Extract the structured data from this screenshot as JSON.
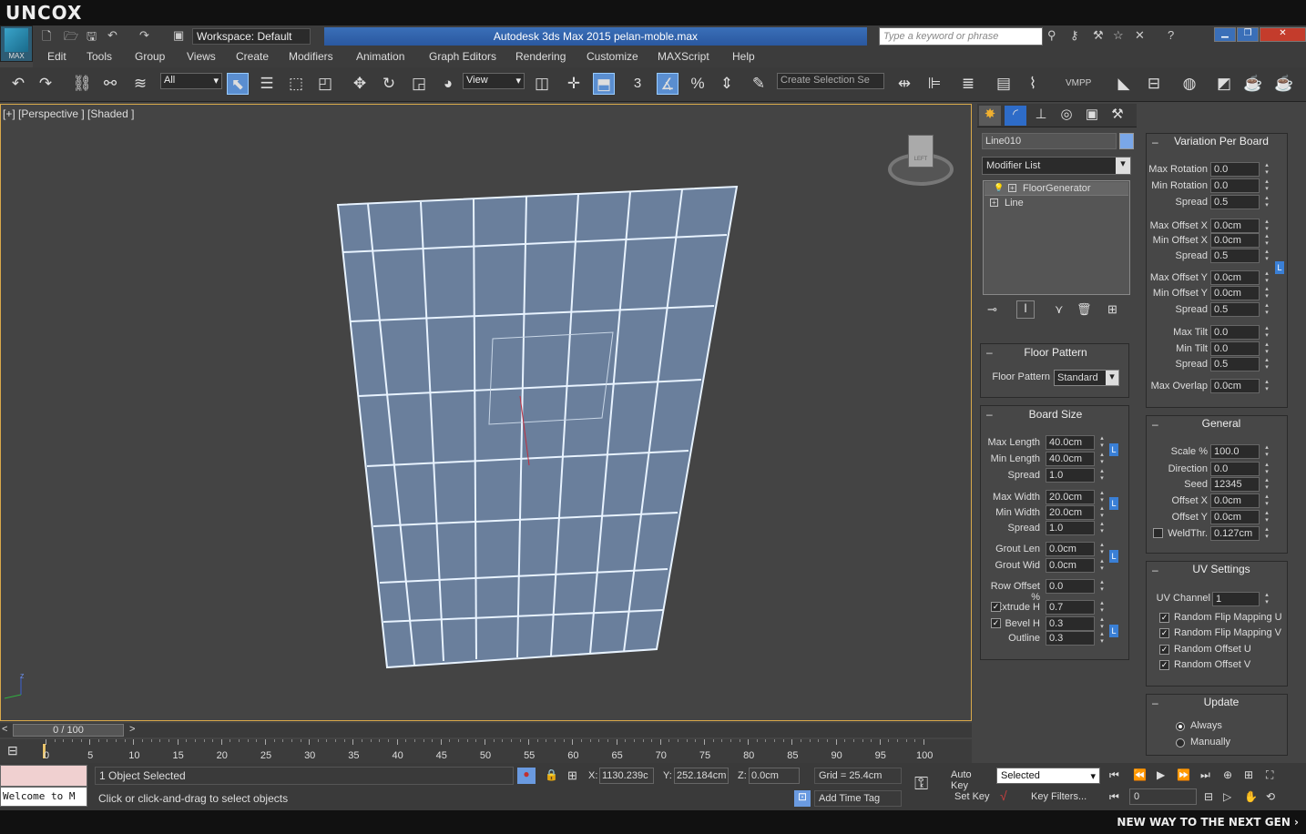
{
  "brand": {
    "logo": "UNCOX",
    "tagline": "NEW WAY TO THE NEXT GEN ›"
  },
  "app": {
    "max_button": "MAX",
    "title": "Autodesk 3ds Max  2015     pelan-moble.max",
    "workspace": "Workspace: Default",
    "search_placeholder": "Type a keyword or phrase"
  },
  "menu": [
    "Edit",
    "Tools",
    "Group",
    "Views",
    "Create",
    "Modifiers",
    "Animation",
    "Graph Editors",
    "Rendering",
    "Customize",
    "MAXScript",
    "Help"
  ],
  "toolbar": {
    "selection_filter": "All",
    "ref_coord": "View",
    "named_selection": "Create Selection Se",
    "snap_3": "3",
    "vmpp": "VMPP"
  },
  "viewport": {
    "label": "[+] [Perspective ] [Shaded ]",
    "viewcube": "LEFT"
  },
  "command_panel": {
    "object_name": "Line010",
    "modifier_list": "Modifier List",
    "stack": [
      "FloorGenerator",
      "Line"
    ],
    "floor_pattern": {
      "title": "Floor Pattern",
      "label": "Floor Pattern",
      "value": "Standard"
    },
    "board_size": {
      "title": "Board Size",
      "fields": [
        {
          "label": "Max Length",
          "value": "40.0cm"
        },
        {
          "label": "Min Length",
          "value": "40.0cm"
        },
        {
          "label": "Spread",
          "value": "1.0"
        },
        {
          "label": "Max Width",
          "value": "20.0cm"
        },
        {
          "label": "Min Width",
          "value": "20.0cm"
        },
        {
          "label": "Spread",
          "value": "1.0"
        },
        {
          "label": "Grout Len",
          "value": "0.0cm"
        },
        {
          "label": "Grout Wid",
          "value": "0.0cm"
        },
        {
          "label": "Row Offset %",
          "value": "0.0"
        },
        {
          "label": "Extrude H",
          "value": "0.7"
        },
        {
          "label": "Bevel    H",
          "value": "0.3"
        },
        {
          "label": "Outline",
          "value": "0.3"
        }
      ]
    }
  },
  "variation": {
    "title": "Variation Per Board",
    "fields": [
      {
        "label": "Max Rotation",
        "value": "0.0"
      },
      {
        "label": "Min Rotation",
        "value": "0.0"
      },
      {
        "label": "Spread",
        "value": "0.5"
      },
      {
        "label": "Max Offset X",
        "value": "0.0cm"
      },
      {
        "label": "Min Offset X",
        "value": "0.0cm"
      },
      {
        "label": "Spread",
        "value": "0.5"
      },
      {
        "label": "Max Offset Y",
        "value": "0.0cm"
      },
      {
        "label": "Min Offset Y",
        "value": "0.0cm"
      },
      {
        "label": "Spread",
        "value": "0.5"
      },
      {
        "label": "Max Tilt",
        "value": "0.0"
      },
      {
        "label": "Min Tilt",
        "value": "0.0"
      },
      {
        "label": "Spread",
        "value": "0.5"
      },
      {
        "label": "Max Overlap",
        "value": "0.0cm"
      }
    ]
  },
  "general": {
    "title": "General",
    "fields": [
      {
        "label": "Scale %",
        "value": "100.0"
      },
      {
        "label": "Direction",
        "value": "0.0"
      },
      {
        "label": "Seed",
        "value": "12345"
      },
      {
        "label": "Offset X",
        "value": "0.0cm"
      },
      {
        "label": "Offset Y",
        "value": "0.0cm"
      },
      {
        "label": "WeldThr.",
        "value": "0.127cm"
      }
    ]
  },
  "uv": {
    "title": "UV Settings",
    "channel_label": "UV Channel",
    "channel_value": "1",
    "options": [
      "Random Flip Mapping U",
      "Random Flip Mapping V",
      "Random Offset U",
      "Random Offset V"
    ]
  },
  "update": {
    "title": "Update",
    "options": [
      "Always",
      "Manually"
    ]
  },
  "timeline": {
    "frame": "0 / 100",
    "ticks": [
      "0",
      "5",
      "10",
      "15",
      "20",
      "25",
      "30",
      "35",
      "40",
      "45",
      "50",
      "55",
      "60",
      "65",
      "70",
      "75",
      "80",
      "85",
      "90",
      "95",
      "100"
    ]
  },
  "status": {
    "listener": "Welcome to M",
    "selected": "1 Object Selected",
    "prompt": "Click or click-and-drag to select objects",
    "x_label": "X:",
    "x": "1130.239c",
    "y_label": "Y:",
    "y": "252.184cm",
    "z_label": "Z:",
    "z": "0.0cm",
    "grid": "Grid = 25.4cm",
    "add_time_tag": "Add Time Tag",
    "auto_key": "Auto Key",
    "set_key": "Set Key",
    "key_mode": "Selected",
    "key_filters": "Key Filters...",
    "current_frame": "0"
  }
}
